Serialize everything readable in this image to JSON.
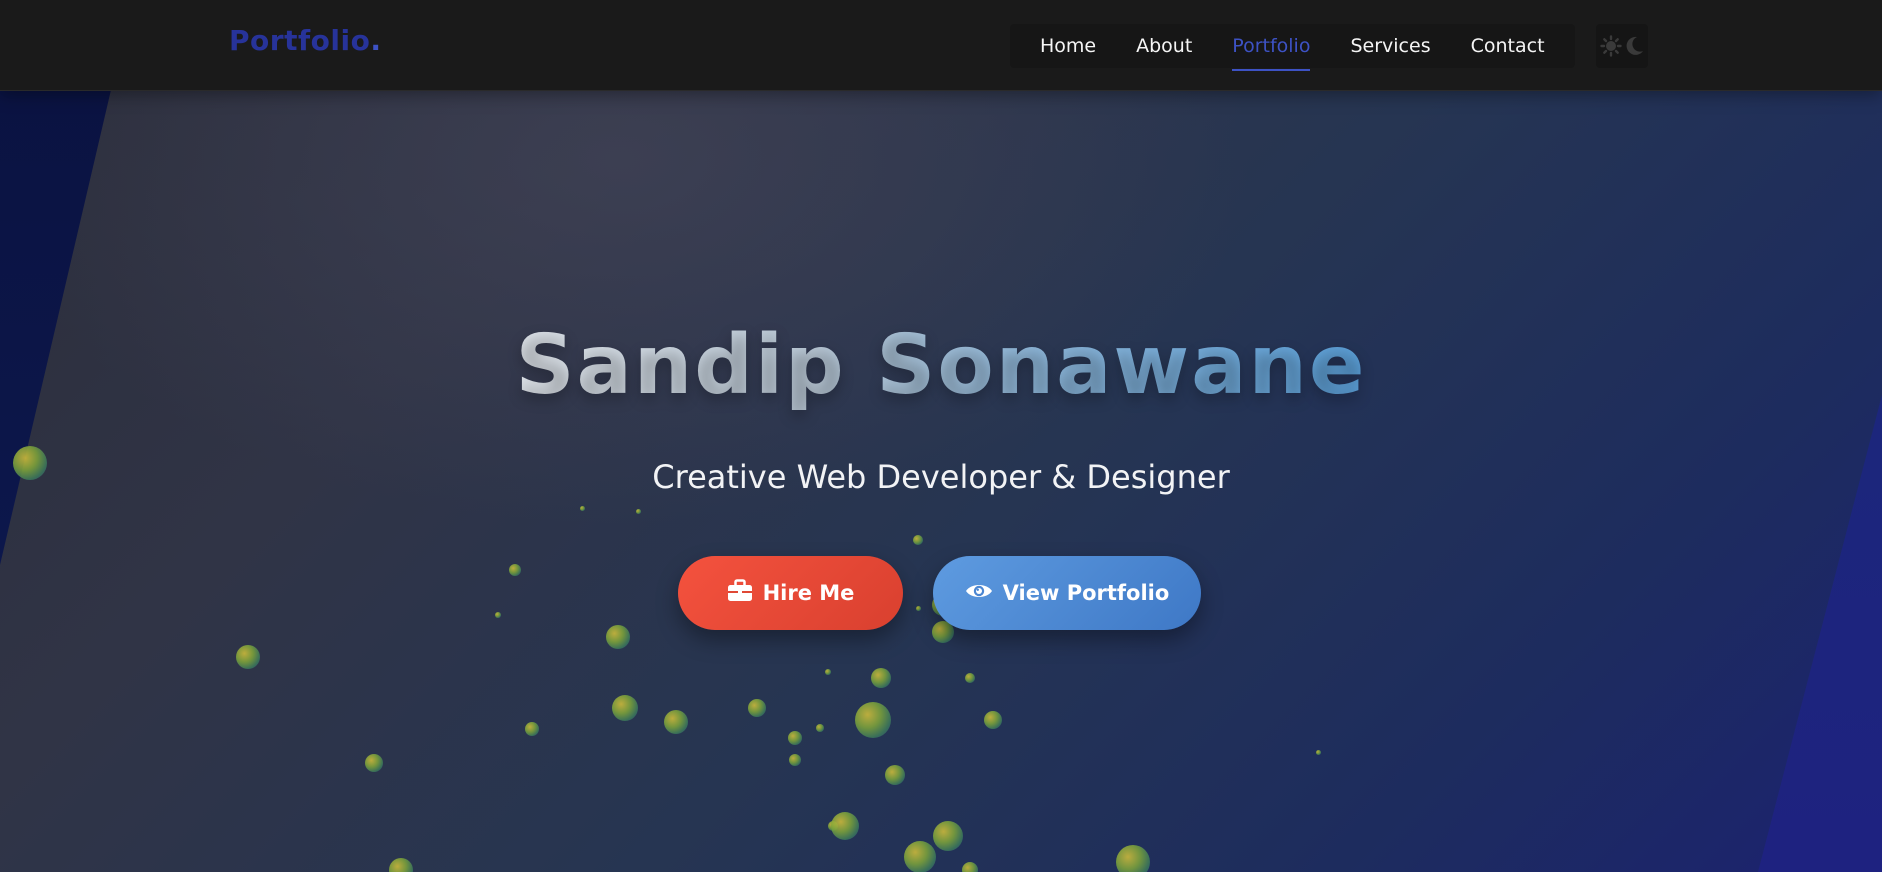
{
  "logo": {
    "text": "Portfolio",
    "dot": "."
  },
  "nav": {
    "items": [
      {
        "label": "Home",
        "active": false
      },
      {
        "label": "About",
        "active": false
      },
      {
        "label": "Portfolio",
        "active": true
      },
      {
        "label": "Services",
        "active": false
      },
      {
        "label": "Contact",
        "active": false
      }
    ],
    "theme_toggle_icons": [
      "sun-icon",
      "moon-icon"
    ]
  },
  "hero": {
    "title": "Sandip Sonawane",
    "subtitle": "Creative Web Developer & Designer",
    "buttons": [
      {
        "label": "Hire Me",
        "icon": "briefcase-icon",
        "color": "#f4523e"
      },
      {
        "label": "View Portfolio",
        "icon": "eye-icon",
        "color": "#5e9be0"
      }
    ]
  },
  "colors": {
    "accent": "#3d52c4",
    "logo": "#27339a",
    "navbar_bg": "#1a1a1a",
    "hire_button": "#f4523e",
    "portfolio_button": "#5e9be0"
  }
}
